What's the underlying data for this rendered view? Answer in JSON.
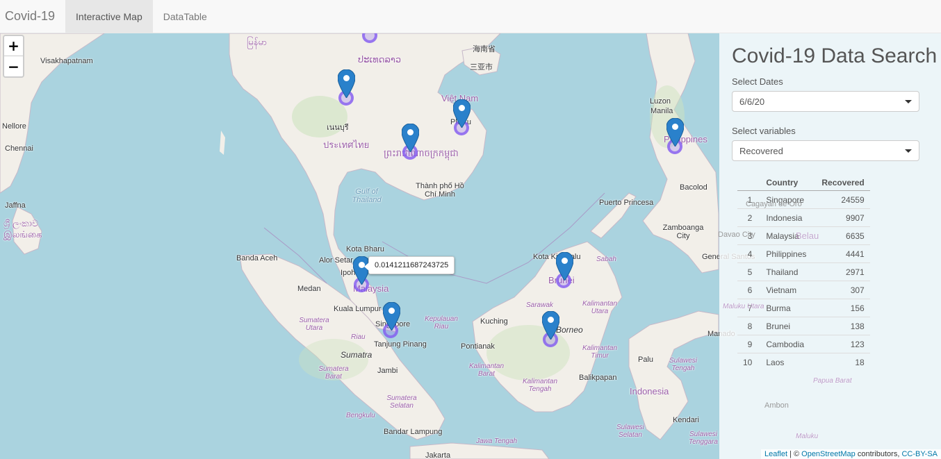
{
  "navbar": {
    "brand": "Covid-19",
    "tabs": [
      {
        "label": "Interactive Map",
        "active": true
      },
      {
        "label": "DataTable",
        "active": false
      }
    ]
  },
  "map": {
    "zoom_in": "+",
    "zoom_out": "−",
    "tooltip": "0.0141211687243725",
    "labels": {
      "visakhapatnam": "Visakhapatnam",
      "nellore": "Nellore",
      "chennai": "Chennai",
      "jaffna": "Jaffna",
      "sri_lanka": "ශ්‍රී ලංකාව இலங்கை",
      "myanmar": "မြန်မာ",
      "laos": "ປະເທດລາວ",
      "thailand": "ประเทศไทย",
      "bangkok": "เนนบุรี",
      "cambodia": "ព្រះរាជាណាចក្រកម្ពុជា",
      "vietnam": "Việt Nam",
      "pleiku": "Pleiku",
      "hochiminh": "Thành phố Hồ Chí Minh",
      "gulf_thailand": "Gulf of Thailand",
      "hainan": "海南省",
      "sanya": "三亚市",
      "luzon": "Luzon",
      "manila": "Manila",
      "philippines": "Philippines",
      "bacolod": "Bacolod",
      "puerto_princesa": "Puerto Princesa",
      "cagayan": "Cagayan de Oro",
      "zamboanga": "Zamboanga City",
      "davao": "Davao City",
      "general_santos": "General Santos",
      "belau": "Belau",
      "banda_aceh": "Banda Aceh",
      "medan": "Medan",
      "kota_bharu": "Kota Bharu",
      "alor_setar": "Alor Setar",
      "ipoh": "Ipoh",
      "malaysia": "Malaysia",
      "kuala_lumpur": "Kuala Lumpur",
      "singapore": "Singapore",
      "tanjung_pinang": "Tanjung Pinang",
      "kepulauan_riau": "Kepulauan Riau",
      "riau": "Riau",
      "sumatra": "Sumatra",
      "sumatera_utara": "Sumatera Utara",
      "sumatera_barat": "Sumatera Barat",
      "jambi": "Jambi",
      "sumatera_selatan": "Sumatera Selatan",
      "bengkulu": "Bengkulu",
      "bandar_lampung": "Bandar Lampung",
      "jakarta": "Jakarta",
      "java_sea": "Jawa Tengah",
      "kota_kinabalu": "Kota Kinabalu",
      "sabah": "Sabah",
      "brunei": "Brunei",
      "sarawak": "Sarawak",
      "kuching": "Kuching",
      "borneo": "Borneo",
      "pontianak": "Pontianak",
      "kalimantan_utara": "Kalimantan Utara",
      "kalimantan_timur": "Kalimantan Timur",
      "kalimantan_barat": "Kalimantan Barat",
      "kalimantan_tengah": "Kalimantan Tengah",
      "balikpapan": "Balikpapan",
      "palu": "Palu",
      "sulawesi_tengah": "Sulawesi Tengah",
      "indonesia": "Indonesia",
      "manado": "Manado",
      "sulawesi_selatan": "Sulawesi Selatan",
      "sulawesi_tenggara": "Sulawesi Tenggara",
      "kendari": "Kendari",
      "ambon": "Ambon",
      "maluku": "Maluku",
      "papua_barat": "Papua Barat",
      "maluku_utara": "Maluku Utara"
    },
    "attribution": {
      "leaflet": "Leaflet",
      "sep": " | © ",
      "osm": "OpenStreetMap",
      "contributors": " contributors, ",
      "license": "CC-BY-SA"
    }
  },
  "panel": {
    "title": "Covid-19 Data Search",
    "dates_label": "Select Dates",
    "dates_value": "6/6/20",
    "variables_label": "Select variables",
    "variables_value": "Recovered",
    "table": {
      "headers": [
        "",
        "Country",
        "Recovered"
      ],
      "rows": [
        [
          "1",
          "Singapore",
          "24559"
        ],
        [
          "2",
          "Indonesia",
          "9907"
        ],
        [
          "3",
          "Malaysia",
          "6635"
        ],
        [
          "4",
          "Philippines",
          "4441"
        ],
        [
          "5",
          "Thailand",
          "2971"
        ],
        [
          "6",
          "Vietnam",
          "307"
        ],
        [
          "7",
          "Burma",
          "156"
        ],
        [
          "8",
          "Brunei",
          "138"
        ],
        [
          "9",
          "Cambodia",
          "123"
        ],
        [
          "10",
          "Laos",
          "18"
        ]
      ]
    }
  },
  "colors": {
    "water": "#aad3df",
    "land": "#f2efe9",
    "marker": "#2a81cb",
    "circle": "#825af0"
  }
}
